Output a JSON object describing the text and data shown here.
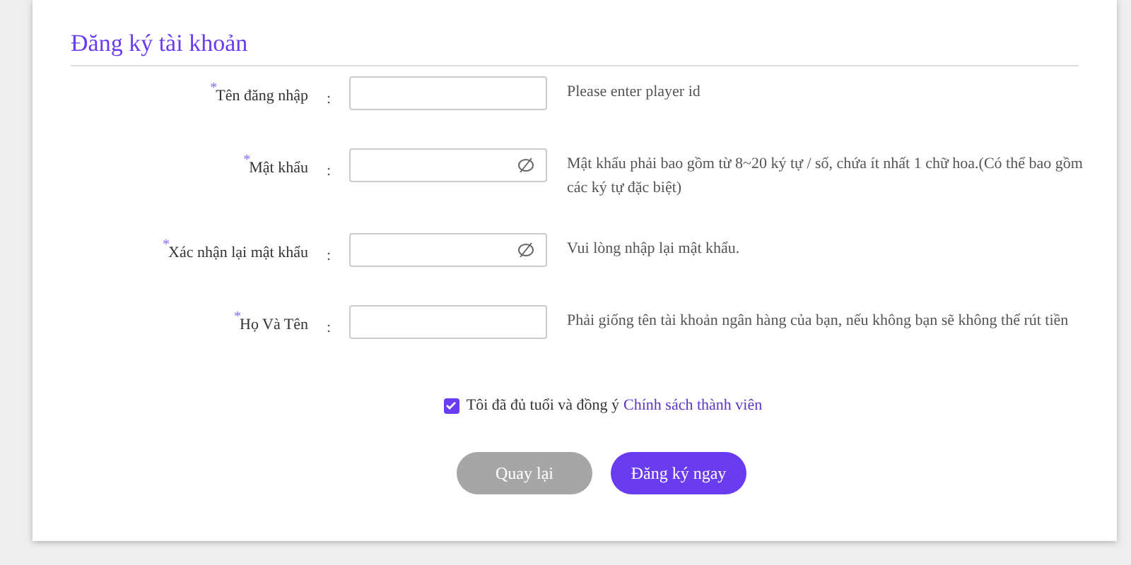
{
  "title": "Đăng ký tài khoản",
  "fields": [
    {
      "label": "Tên đăng nhập",
      "kind": "text",
      "help": "Please enter player id"
    },
    {
      "label": "Mật khẩu",
      "kind": "password",
      "help": "Mật khẩu phải bao gồm từ 8~20 ký tự / số, chứa ít nhất 1 chữ hoa.(Có thể bao gồm các ký tự đặc biệt)"
    },
    {
      "label": "Xác nhận lại mật khẩu",
      "kind": "password",
      "help": "Vui lòng nhập lại mật khẩu."
    },
    {
      "label": "Họ Và Tên",
      "kind": "text",
      "help": "Phải giống tên tài khoản ngân hàng của bạn, nếu không bạn sẽ không thể rút tiền"
    }
  ],
  "required_mark": "*",
  "separator": ":",
  "agreement": {
    "checked": true,
    "text": "Tôi đã đủ tuổi và đồng ý",
    "link": "Chính sách thành viên"
  },
  "buttons": [
    {
      "label": "Quay lại",
      "kind": "secondary"
    },
    {
      "label": "Đăng ký ngay",
      "kind": "primary"
    }
  ]
}
